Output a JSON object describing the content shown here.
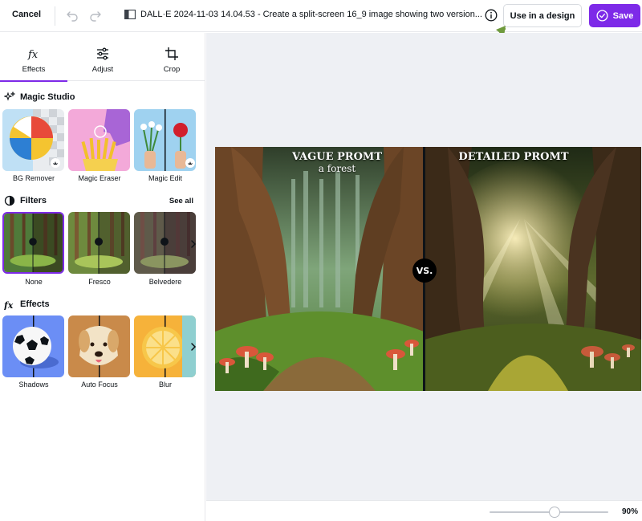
{
  "topbar": {
    "cancel_label": "Cancel",
    "file_title": "DALL·E 2024-11-03 14.04.53 - Create a split-screen 16_9 image showing two version...",
    "use_in_design_label": "Use in a design",
    "save_label": "Save"
  },
  "tabs": [
    {
      "label": "Effects",
      "icon": "fx-icon",
      "active": true
    },
    {
      "label": "Adjust",
      "icon": "sliders-icon"
    },
    {
      "label": "Crop",
      "icon": "crop-icon"
    }
  ],
  "magic_studio": {
    "heading": "Magic Studio",
    "items": [
      {
        "label": "BG Remover",
        "premium": true
      },
      {
        "label": "Magic Eraser"
      },
      {
        "label": "Magic Edit",
        "premium": true
      }
    ]
  },
  "filters": {
    "heading": "Filters",
    "see_all": "See all",
    "items": [
      {
        "label": "None",
        "selected": true
      },
      {
        "label": "Fresco"
      },
      {
        "label": "Belvedere"
      }
    ]
  },
  "effects": {
    "heading": "Effects",
    "items": [
      {
        "label": "Shadows"
      },
      {
        "label": "Auto Focus"
      },
      {
        "label": "Blur"
      }
    ]
  },
  "canvas": {
    "left_title": "VAGUE PROMT",
    "left_subtitle": "a forest",
    "right_title": "DETAILED PROMT",
    "vs_label": "VS."
  },
  "zoom": {
    "label": "90%",
    "value_percent": 90
  },
  "colors": {
    "accent": "#7d2ae8",
    "annotation_arrow": "#6f9a3d"
  }
}
